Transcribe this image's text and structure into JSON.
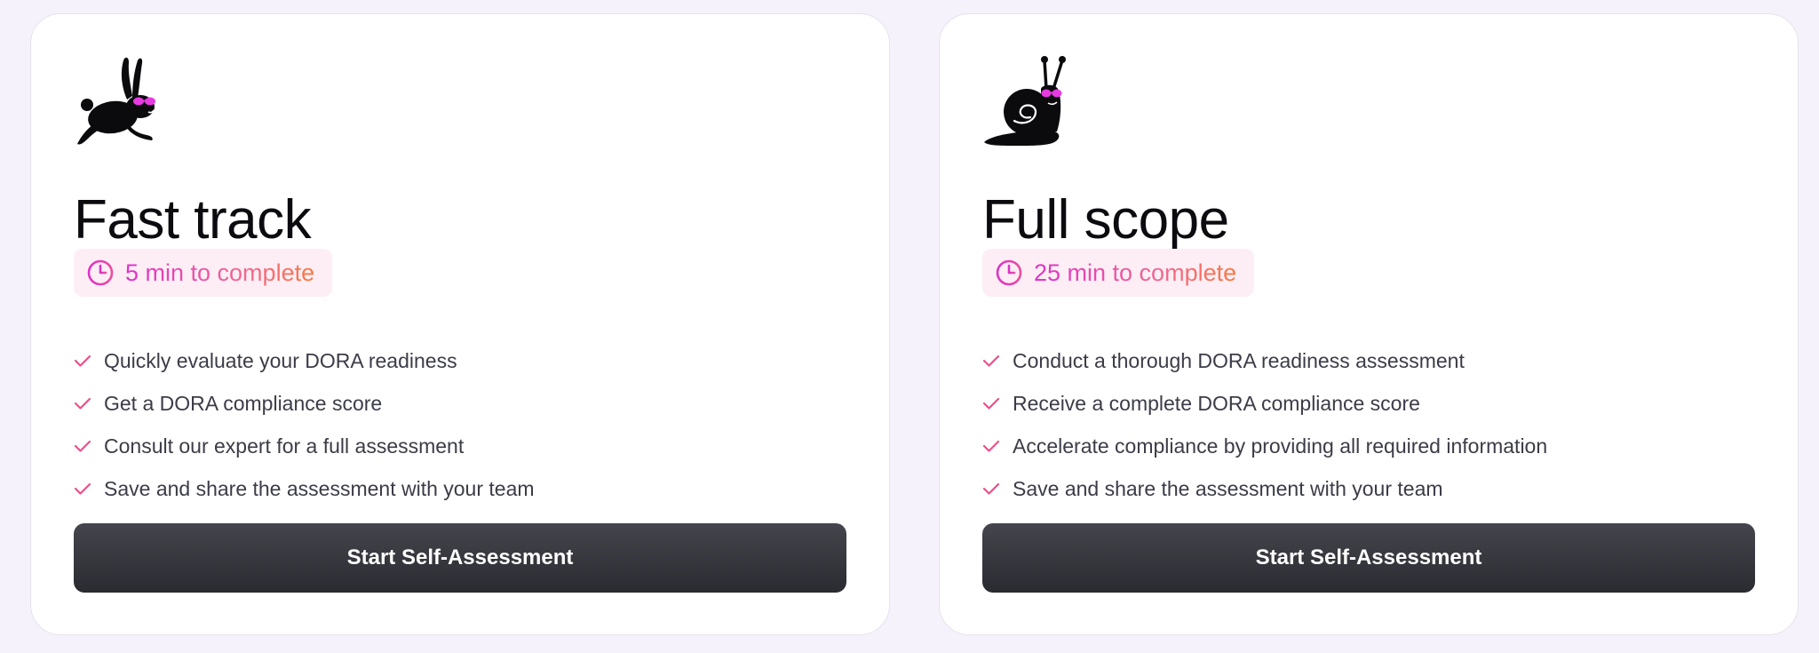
{
  "colors": {
    "accent_gradient_start": "#dd33c9",
    "accent_gradient_end": "#f9783f",
    "badge_bg": "#fdeef5",
    "check_color": "#ec4f8c",
    "button_bg": "#2e2e35"
  },
  "plans": [
    {
      "mascot": "rabbit-with-sunglasses",
      "title": "Fast track",
      "duration_icon": "clock-icon",
      "duration": "5 min to complete",
      "features": [
        "Quickly evaluate your DORA readiness",
        "Get a DORA compliance score",
        "Consult our expert for a full assessment",
        "Save and share the assessment with your team"
      ],
      "cta_label": "Start Self-Assessment"
    },
    {
      "mascot": "snail-with-sunglasses",
      "title": "Full scope",
      "duration_icon": "clock-icon",
      "duration": "25 min to complete",
      "features": [
        "Conduct a thorough DORA readiness assessment",
        "Receive a complete DORA compliance score",
        "Accelerate compliance by providing all required information",
        "Save and share the assessment with your team"
      ],
      "cta_label": "Start Self-Assessment"
    }
  ]
}
